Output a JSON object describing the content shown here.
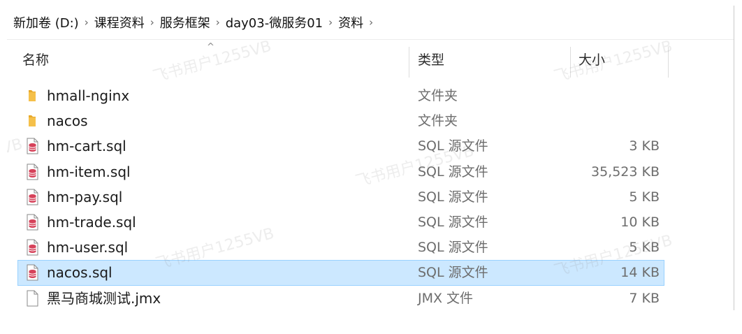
{
  "breadcrumb": [
    "新加卷 (D:)",
    "课程资料",
    "服务框架",
    "day03-微服务01",
    "资料"
  ],
  "columns": {
    "name": "名称",
    "type": "类型",
    "size": "大小"
  },
  "files": [
    {
      "name": "hmall-nginx",
      "type": "文件夹",
      "size": "",
      "icon": "folder-icon"
    },
    {
      "name": "nacos",
      "type": "文件夹",
      "size": "",
      "icon": "folder-icon"
    },
    {
      "name": "hm-cart.sql",
      "type": "SQL 源文件",
      "size": "3 KB",
      "icon": "sql-file-icon"
    },
    {
      "name": "hm-item.sql",
      "type": "SQL 源文件",
      "size": "35,523 KB",
      "icon": "sql-file-icon"
    },
    {
      "name": "hm-pay.sql",
      "type": "SQL 源文件",
      "size": "5 KB",
      "icon": "sql-file-icon"
    },
    {
      "name": "hm-trade.sql",
      "type": "SQL 源文件",
      "size": "10 KB",
      "icon": "sql-file-icon"
    },
    {
      "name": "hm-user.sql",
      "type": "SQL 源文件",
      "size": "5 KB",
      "icon": "sql-file-icon"
    },
    {
      "name": "nacos.sql",
      "type": "SQL 源文件",
      "size": "14 KB",
      "icon": "sql-file-icon",
      "selected": true
    },
    {
      "name": "黑马商城测试.jmx",
      "type": "JMX 文件",
      "size": "7 KB",
      "icon": "blank-file-icon"
    }
  ],
  "watermark": "飞书用户1255VB",
  "colors": {
    "selection": "#cce8ff",
    "selection_border": "#99d1ff",
    "folder": "#f5c04a",
    "sql_icon": "#d6425a"
  }
}
